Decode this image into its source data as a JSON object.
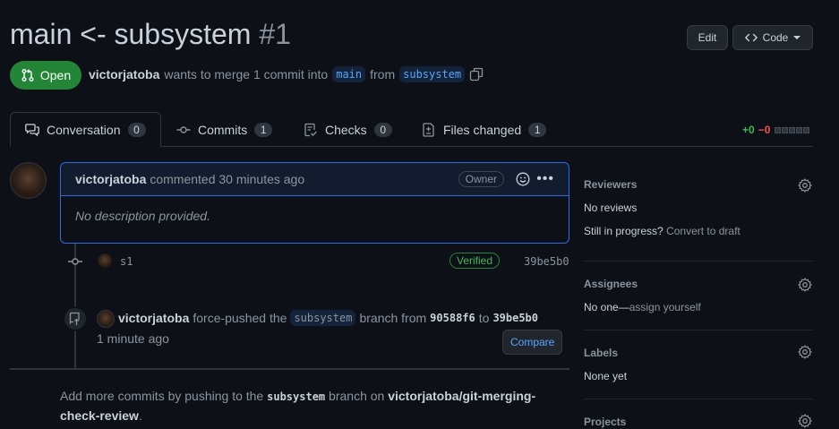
{
  "header": {
    "title": "main <- subsystem",
    "number": "#1",
    "edit_label": "Edit",
    "code_label": "Code",
    "state_label": "Open",
    "author": "victorjatoba",
    "merge_text_1": "wants to merge 1 commit into",
    "base_branch": "main",
    "merge_text_2": "from",
    "head_branch": "subsystem"
  },
  "tabs": [
    {
      "label": "Conversation",
      "count": "0"
    },
    {
      "label": "Commits",
      "count": "1"
    },
    {
      "label": "Checks",
      "count": "0"
    },
    {
      "label": "Files changed",
      "count": "1"
    }
  ],
  "diffstat": {
    "additions": "+0",
    "deletions": "−0"
  },
  "comment": {
    "author": "victorjatoba",
    "meta": "commented 30 minutes ago",
    "role_badge": "Owner",
    "body": "No description provided."
  },
  "commit": {
    "message": "s1",
    "verified": "Verified",
    "sha": "39be5b0"
  },
  "force_push": {
    "author": "victorjatoba",
    "text_1": "force-pushed the",
    "branch": "subsystem",
    "text_2": "branch from",
    "from_sha": "90588f6",
    "text_3": "to",
    "to_sha": "39be5b0",
    "time": "1 minute ago",
    "compare_label": "Compare"
  },
  "footer": {
    "text_1": "Add more commits by pushing to the",
    "branch": "subsystem",
    "text_2": "branch on",
    "repo": "victorjatoba/git-merging-check-review",
    "text_3": "."
  },
  "sidebar": {
    "reviewers": {
      "title": "Reviewers",
      "value": "No reviews",
      "draft_question": "Still in progress?",
      "draft_link": "Convert to draft"
    },
    "assignees": {
      "title": "Assignees",
      "value_prefix": "No one—",
      "value_link": "assign yourself"
    },
    "labels": {
      "title": "Labels",
      "value": "None yet"
    },
    "projects": {
      "title": "Projects"
    }
  },
  "colors": {
    "open_green": "#238636",
    "accent_blue": "#1f6feb",
    "link_blue": "#58a6ff"
  }
}
